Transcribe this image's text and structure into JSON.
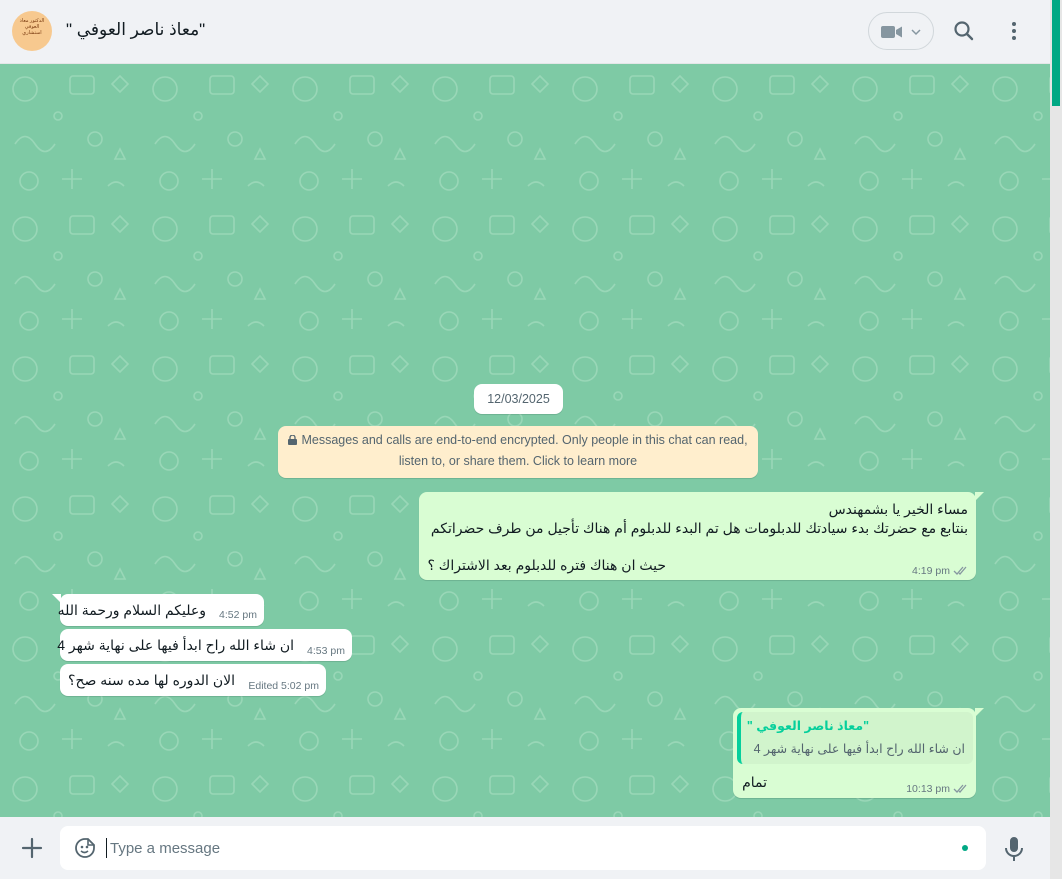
{
  "header": {
    "contact_name": "\"معاذ ناصر العوفي \"",
    "avatar_text": "الدكتور معاذ العوفي استشاري"
  },
  "chat": {
    "date_chip": "12/03/2025",
    "encryption_line1": "Messages and calls are end-to-end encrypted. Only people in this chat can read,",
    "encryption_line2": "listen to, or share them. Click to learn more",
    "messages": [
      {
        "direction": "out",
        "lines": [
          "مساء الخير يا بشمهندس",
          "بنتابع مع حضرتك بدء سيادتك للدبلومات هل تم البدء للدبلوم أم هناك تأجيل من طرف حضراتكم",
          "حيث ان هناك فتره للدبلوم بعد الاشتراك ؟"
        ],
        "time": "4:19 pm"
      },
      {
        "direction": "in",
        "text": "وعليكم السلام ورحمة الله",
        "time": "4:52 pm"
      },
      {
        "direction": "in",
        "text": "ان شاء الله راح ابدأ فيها على نهاية شهر 4",
        "time": "4:53 pm"
      },
      {
        "direction": "in",
        "text": "الان الدوره لها مده سنه صح؟",
        "time": "Edited 5:02 pm"
      },
      {
        "direction": "out",
        "quote_name": "\"معاذ ناصر العوفي \"",
        "quote_text": "ان شاء الله راح ابدأ فيها على نهاية شهر 4",
        "text": "تمام",
        "time": "10:13 pm"
      }
    ]
  },
  "footer": {
    "placeholder": "Type a message"
  },
  "colors": {
    "wallpaper": "#7ecaa5",
    "outgoing_bubble": "#d9fdd3",
    "incoming_bubble": "#ffffff",
    "accent": "#00a884",
    "quote_accent": "#06cf9c",
    "encryption_note": "#ffeecd"
  },
  "icons": [
    "video-icon",
    "chevron-down-icon",
    "search-icon",
    "menu-icon",
    "lock-icon",
    "double-check-icon",
    "plus-icon",
    "emoji-icon",
    "mic-icon"
  ]
}
